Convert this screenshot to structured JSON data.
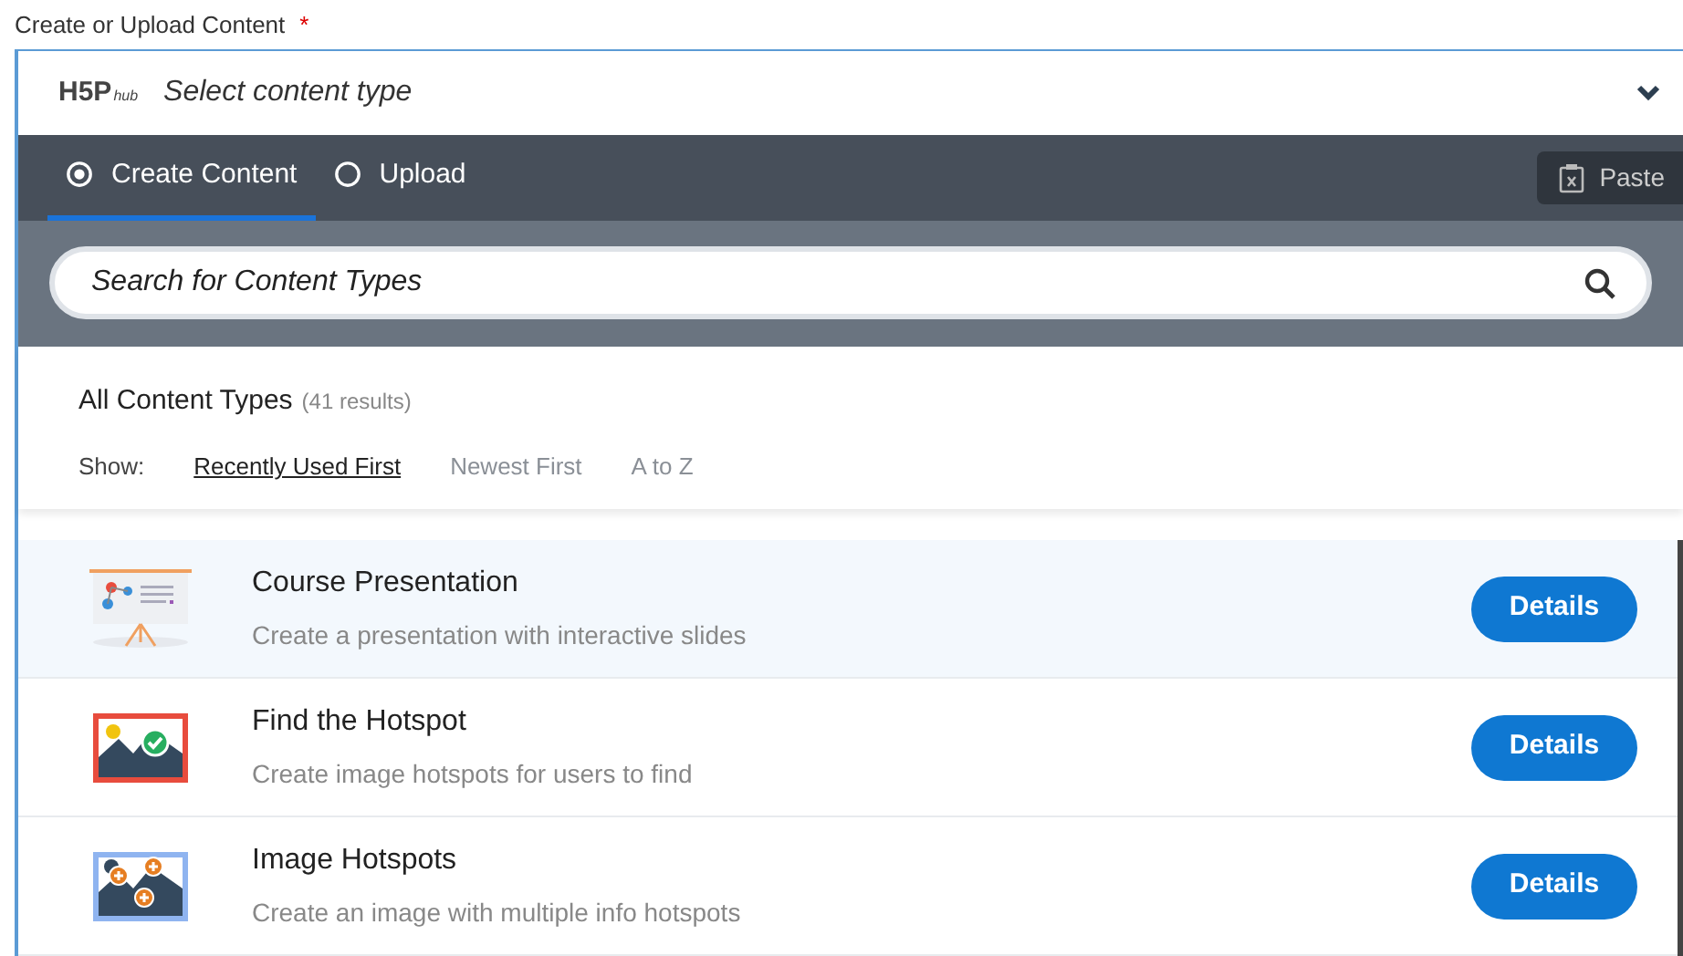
{
  "field_label": "Create or Upload Content",
  "required_mark": "*",
  "selector": {
    "logo": "H5P",
    "logo_sub": "hub",
    "title": "Select content type",
    "expanded": true
  },
  "tabs": [
    {
      "label": "Create Content",
      "selected": true
    },
    {
      "label": "Upload",
      "selected": false
    }
  ],
  "paste_button": "Paste",
  "search": {
    "placeholder": "Search for Content Types"
  },
  "list_header": {
    "title": "All Content Types",
    "count": "(41 results)"
  },
  "sort": {
    "label": "Show:",
    "options": [
      {
        "label": "Recently Used First",
        "selected": true
      },
      {
        "label": "Newest First",
        "selected": false
      },
      {
        "label": "A to Z",
        "selected": false
      }
    ]
  },
  "content_types": [
    {
      "kind": "presentation",
      "title": "Course Presentation",
      "description": "Create a presentation with interactive slides",
      "selected": true,
      "button": "Details"
    },
    {
      "kind": "find-hotspot",
      "title": "Find the Hotspot",
      "description": "Create image hotspots for users to find",
      "selected": false,
      "button": "Details"
    },
    {
      "kind": "image-hotspots",
      "title": "Image Hotspots",
      "description": "Create an image with multiple info hotspots",
      "selected": false,
      "button": "Details"
    }
  ]
}
